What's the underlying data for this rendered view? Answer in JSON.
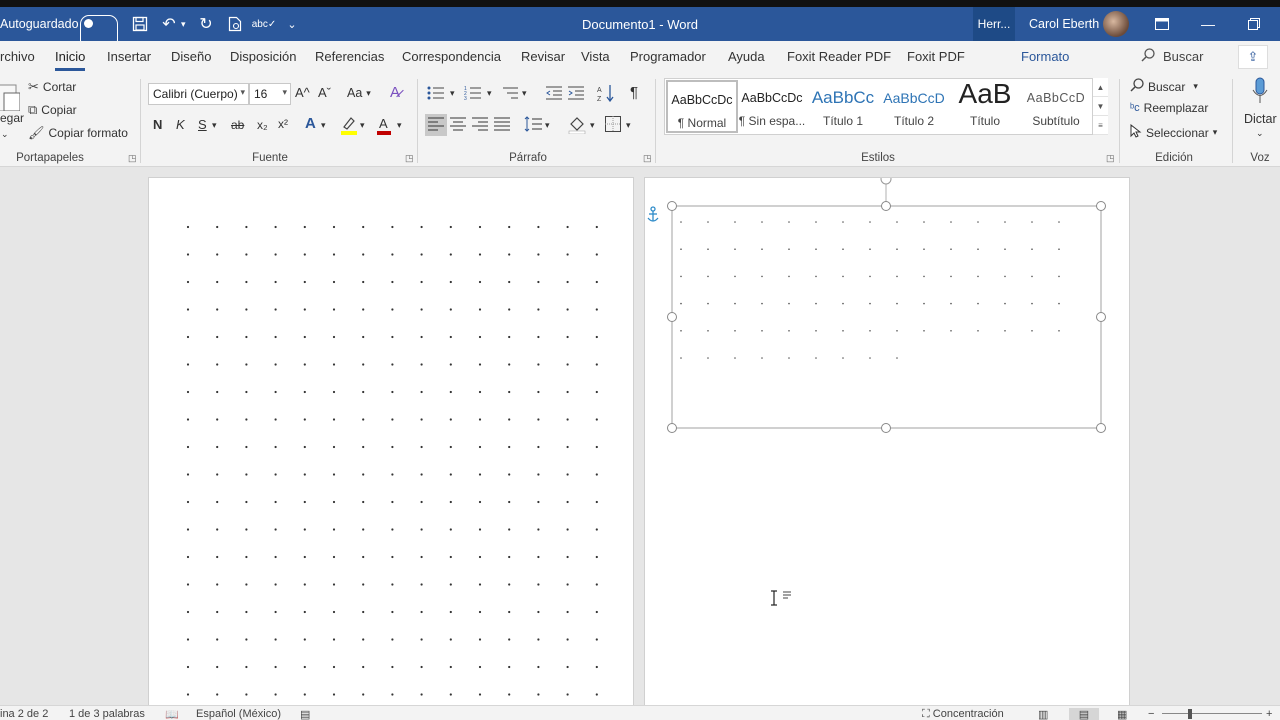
{
  "titlebar": {
    "autosave_label": "Autoguardado",
    "document_title": "Documento1  -  Word",
    "tools_tab": "Herr...",
    "user_name": "Carol Eberth"
  },
  "tabs": [
    {
      "label": "rchivo"
    },
    {
      "label": "Inicio"
    },
    {
      "label": "Insertar"
    },
    {
      "label": "Diseño"
    },
    {
      "label": "Disposición"
    },
    {
      "label": "Referencias"
    },
    {
      "label": "Correspondencia"
    },
    {
      "label": "Revisar"
    },
    {
      "label": "Vista"
    },
    {
      "label": "Programador"
    },
    {
      "label": "Ayuda"
    },
    {
      "label": "Foxit Reader PDF"
    },
    {
      "label": "Foxit PDF"
    },
    {
      "label": "Formato"
    }
  ],
  "search_label": "Buscar",
  "clipboard": {
    "paste_label": "egar",
    "cut": "Cortar",
    "copy": "Copiar",
    "format_painter": "Copiar formato",
    "group": "Portapapeles"
  },
  "font": {
    "family": "Calibri (Cuerpo)",
    "size": "16",
    "bold": "N",
    "italic": "K",
    "underline": "S",
    "strike": "ab",
    "subscript": "x₂",
    "superscript": "x²",
    "grow": "A^",
    "shrink": "Aˇ",
    "case": "Aa",
    "group": "Fuente"
  },
  "paragraph": {
    "group": "Párrafo"
  },
  "styles": {
    "group": "Estilos",
    "items": [
      {
        "preview": "AaBbCcDc",
        "name": "¶ Normal"
      },
      {
        "preview": "AaBbCcDc",
        "name": "¶ Sin espa..."
      },
      {
        "preview": "AaBbCc",
        "name": "Título 1"
      },
      {
        "preview": "AaBbCcD",
        "name": "Título 2"
      },
      {
        "preview": "AaB",
        "name": "Título"
      },
      {
        "preview": "AaBbCcD",
        "name": "Subtítulo"
      }
    ]
  },
  "editing": {
    "find": "Buscar",
    "replace": "Reemplazar",
    "select": "Seleccionar",
    "group": "Edición"
  },
  "voice": {
    "dictate": "Dictar",
    "group": "Voz"
  },
  "statusbar": {
    "page": "ina 2 de 2",
    "words": "1 de 3 palabras",
    "language": "Español (México)",
    "focus": "Concentración"
  },
  "colors": {
    "titlebar": "#2b579a",
    "accent": "#2b579a",
    "highlight": "#ffff00",
    "font_color": "#c00000"
  }
}
